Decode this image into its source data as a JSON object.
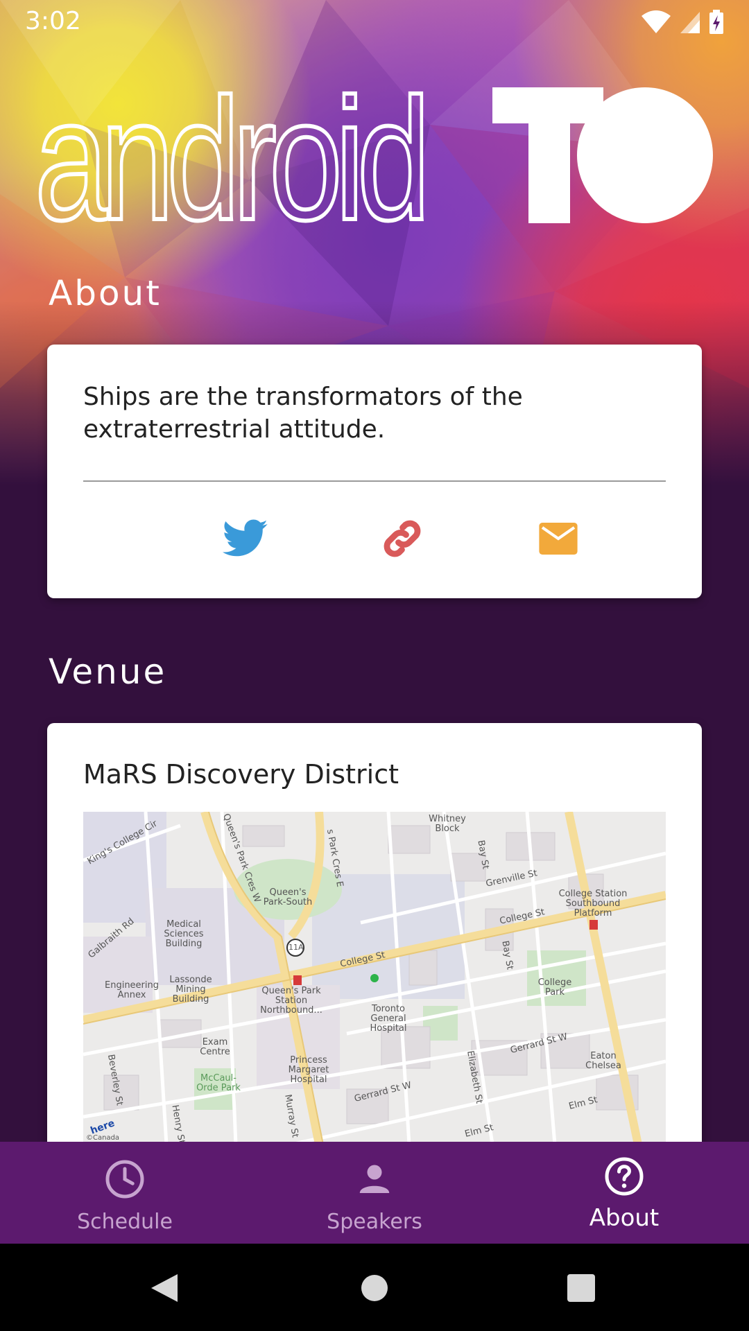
{
  "status_bar": {
    "time": "3:02"
  },
  "header": {
    "logo_text": "android",
    "logo_suffix": "TO"
  },
  "about": {
    "title": "About",
    "description": "Ships are the transformators of the extraterrestrial attitude.",
    "links": [
      {
        "icon": "twitter-icon",
        "color": "#3a9ad9"
      },
      {
        "icon": "link-icon",
        "color": "#d95a5a"
      },
      {
        "icon": "mail-icon",
        "color": "#f2a93b"
      }
    ]
  },
  "venue": {
    "title": "Venue",
    "name": "MaRS Discovery District",
    "map_labels": {
      "queens_park_south": "Queen's Park-South",
      "college_st": "College St",
      "college_st_2": "College St",
      "bay_st": "Bay St",
      "bay_st_2": "Bay St",
      "grenville_st": "Grenville St",
      "whitney_block": "Whitney Block",
      "college_station": "College Station Southbound Platform",
      "medical_sciences": "Medical Sciences Building",
      "engineering_annex": "Engineering Annex",
      "lassonde": "Lassonde Mining Building",
      "queens_park_station": "Queen's Park Station Northbound...",
      "toronto_general": "Toronto General Hospital",
      "college_park": "College Park",
      "exam_centre": "Exam Centre",
      "princess_margaret": "Princess Margaret Hospital",
      "mccaul_orde": "McCaul-Orde Park",
      "gerrard_st_w": "Gerrard St W",
      "gerrard_st_w_2": "Gerrard St W",
      "eaton_chelsea": "Eaton Chelsea",
      "elm_st": "Elm St",
      "elm_st_2": "Elm St",
      "elizabeth_st": "Elizabeth St",
      "murray_st": "Murray St",
      "henry_st": "Henry St",
      "beverley_st": "Beverley St",
      "galbraith_rd": "Galbraith Rd",
      "kings_college_cir": "King's College Cir",
      "queens_park_cres_w": "Queen's Park Cres W",
      "queens_park_cres_e": "s Park Cres E",
      "route_11a": "11A",
      "here_logo": "here",
      "copyright": "©Canada"
    }
  },
  "bottom_nav": {
    "items": [
      {
        "label": "Schedule",
        "icon": "clock-icon"
      },
      {
        "label": "Speakers",
        "icon": "person-icon"
      },
      {
        "label": "About",
        "icon": "help-circle-icon",
        "active": true
      }
    ]
  },
  "colors": {
    "background": "#33103d",
    "nav_bar": "#5c1a6e",
    "nav_inactive": "#c7a4cf",
    "nav_active": "#ffffff"
  }
}
